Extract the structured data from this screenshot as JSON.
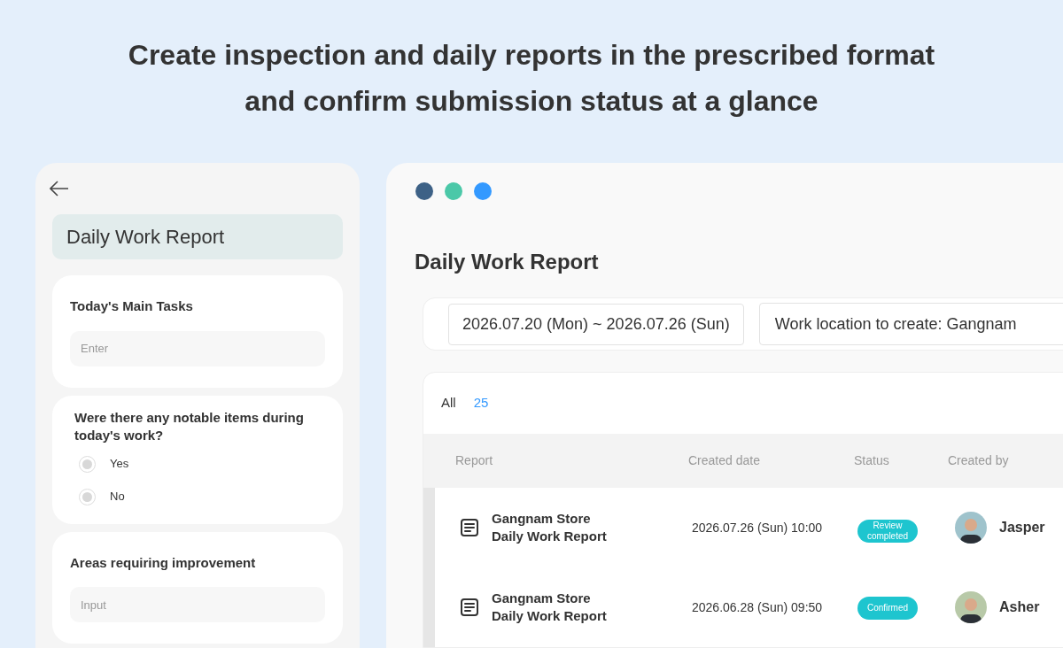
{
  "headline": "Create inspection and daily reports in the prescribed format\nand confirm submission status at a glance",
  "mobile": {
    "title": "Daily Work Report",
    "cards": [
      {
        "kind": "text",
        "label": "Today's Main Tasks",
        "placeholder": "Enter"
      },
      {
        "kind": "radio",
        "label": "Were there any notable items during today's work?",
        "options": [
          {
            "label": "Yes",
            "selected": false
          },
          {
            "label": "No",
            "selected": false
          }
        ]
      },
      {
        "kind": "text",
        "label": "Areas requiring improvement",
        "placeholder": "Input"
      }
    ]
  },
  "window": {
    "dots": [
      {
        "color": "#3d6186"
      },
      {
        "color": "#4bc8a8"
      },
      {
        "color": "#3399ff"
      }
    ],
    "title": "Daily Work Report",
    "filters": {
      "period": "2026.07.20 (Mon) ~ 2026.07.26 (Sun)",
      "location": "Work location to create: Gangnam"
    },
    "tabs": [
      {
        "label": "All",
        "count": "25"
      }
    ],
    "table": {
      "columns": [
        "Report",
        "Created date",
        "Status",
        "Created by"
      ],
      "rows": [
        {
          "report": "Gangnam Store\nDaily Work Report",
          "date": "2026.07.26 (Sun) 10:00",
          "status": "Review\ncompleted",
          "author": "Jasper"
        },
        {
          "report": "Gangnam Store\nDaily Work Report",
          "date": "2026.06.28 (Sun) 09:50",
          "status": "Confirmed",
          "author": "Asher"
        }
      ]
    }
  }
}
